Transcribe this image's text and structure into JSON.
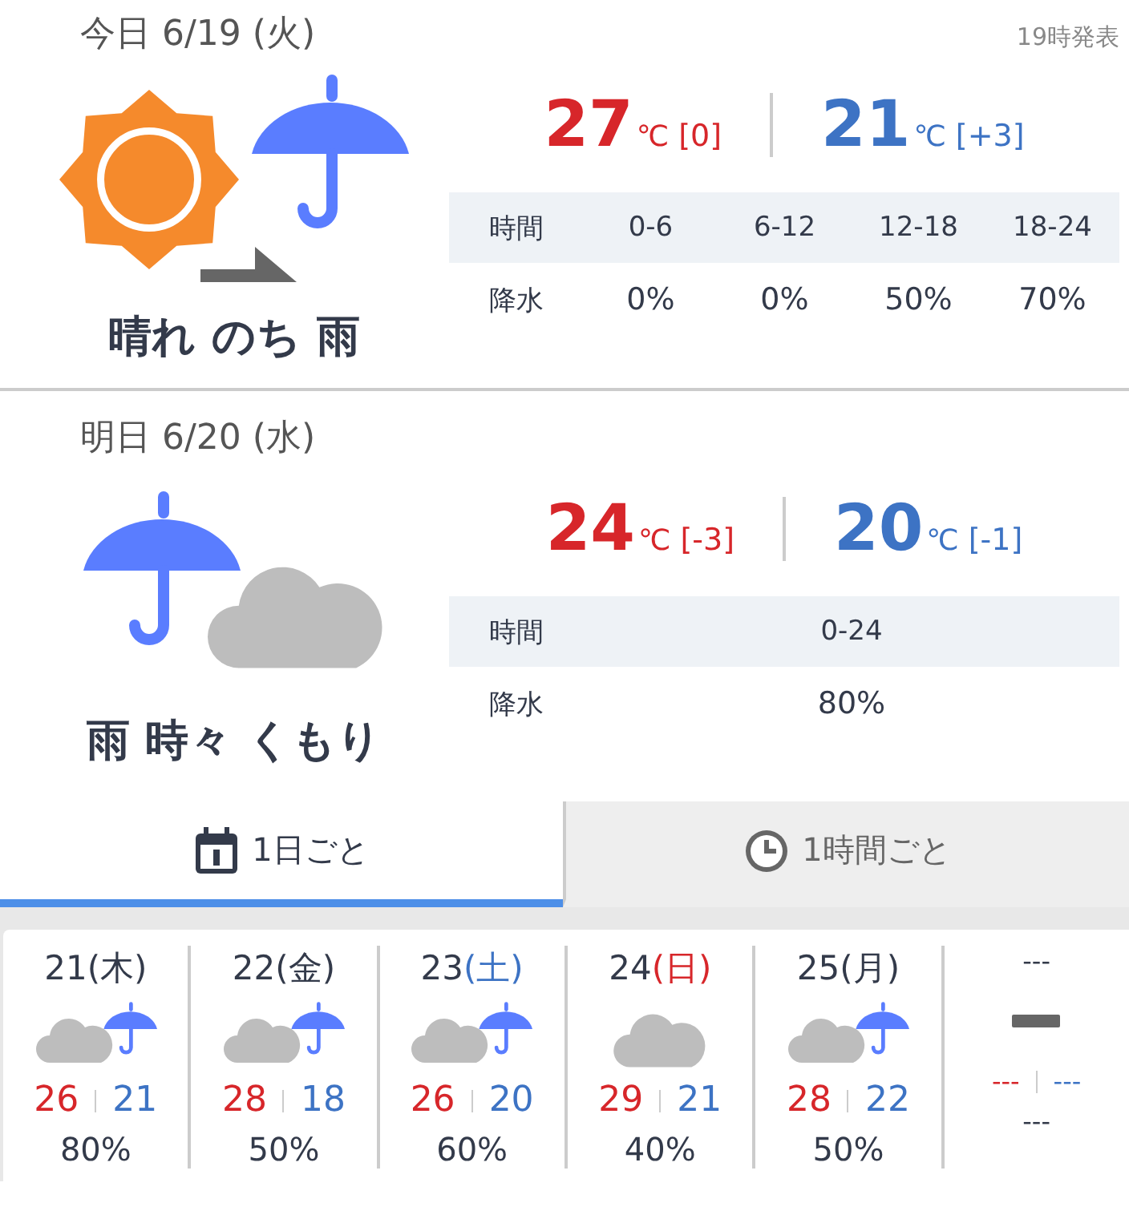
{
  "days": [
    {
      "label": "今日",
      "date": "6/19",
      "weekday": "(火)",
      "issued": "19時発表",
      "icons": [
        {
          "kind": "sun"
        },
        {
          "kind": "later"
        },
        {
          "kind": "umbrella"
        }
      ],
      "weather": "晴れ のち 雨",
      "high": {
        "value": "27",
        "unit": "℃",
        "diff": "[0]"
      },
      "low": {
        "value": "21",
        "unit": "℃",
        "diff": "[+3]"
      },
      "table": {
        "head": {
          "label": "時間",
          "cells": [
            "0-6",
            "6-12",
            "12-18",
            "18-24"
          ]
        },
        "rain": {
          "label": "降水",
          "cells": [
            "0%",
            "0%",
            "50%",
            "70%"
          ]
        }
      }
    },
    {
      "label": "明日",
      "date": "6/20",
      "weekday": "(水)",
      "icons": [
        {
          "kind": "umbrella"
        },
        {
          "kind": "cloud"
        }
      ],
      "weather": "雨 時々 くもり",
      "high": {
        "value": "24",
        "unit": "℃",
        "diff": "[-3]"
      },
      "low": {
        "value": "20",
        "unit": "℃",
        "diff": "[-1]"
      },
      "table": {
        "head": {
          "label": "時間",
          "cells": [
            "0-24"
          ]
        },
        "rain": {
          "label": "降水",
          "cells": [
            "80%"
          ]
        }
      }
    }
  ],
  "tabs": [
    {
      "label": "1日ごと",
      "kind": "calendar",
      "selected": true
    },
    {
      "label": "1時間ごと",
      "kind": "clock",
      "selected": false
    }
  ],
  "week": [
    {
      "date": "21",
      "weekday": "(木)",
      "color": "#333a4a",
      "icons": [
        {
          "kind": "cloud"
        },
        {
          "kind": "umbrella"
        }
      ],
      "high": "26",
      "low": "21",
      "rain": "80%"
    },
    {
      "date": "22",
      "weekday": "(金)",
      "color": "#333a4a",
      "icons": [
        {
          "kind": "cloud"
        },
        {
          "kind": "umbrella"
        }
      ],
      "high": "28",
      "low": "18",
      "rain": "50%"
    },
    {
      "date": "23",
      "weekday": "(土)",
      "color": "#3d73c4",
      "icons": [
        {
          "kind": "cloud"
        },
        {
          "kind": "umbrella"
        }
      ],
      "high": "26",
      "low": "20",
      "rain": "60%"
    },
    {
      "date": "24",
      "weekday": "(日)",
      "color": "#d7262a",
      "icons": [
        {
          "kind": "cloud"
        }
      ],
      "high": "29",
      "low": "21",
      "rain": "40%"
    },
    {
      "date": "25",
      "weekday": "(月)",
      "color": "#333a4a",
      "icons": [
        {
          "kind": "cloud"
        },
        {
          "kind": "umbrella"
        }
      ],
      "high": "28",
      "low": "22",
      "rain": "50%"
    },
    {
      "date": "---",
      "icons": [
        {
          "kind": "none"
        }
      ],
      "high": "---",
      "low": "---",
      "rain": "---"
    }
  ]
}
